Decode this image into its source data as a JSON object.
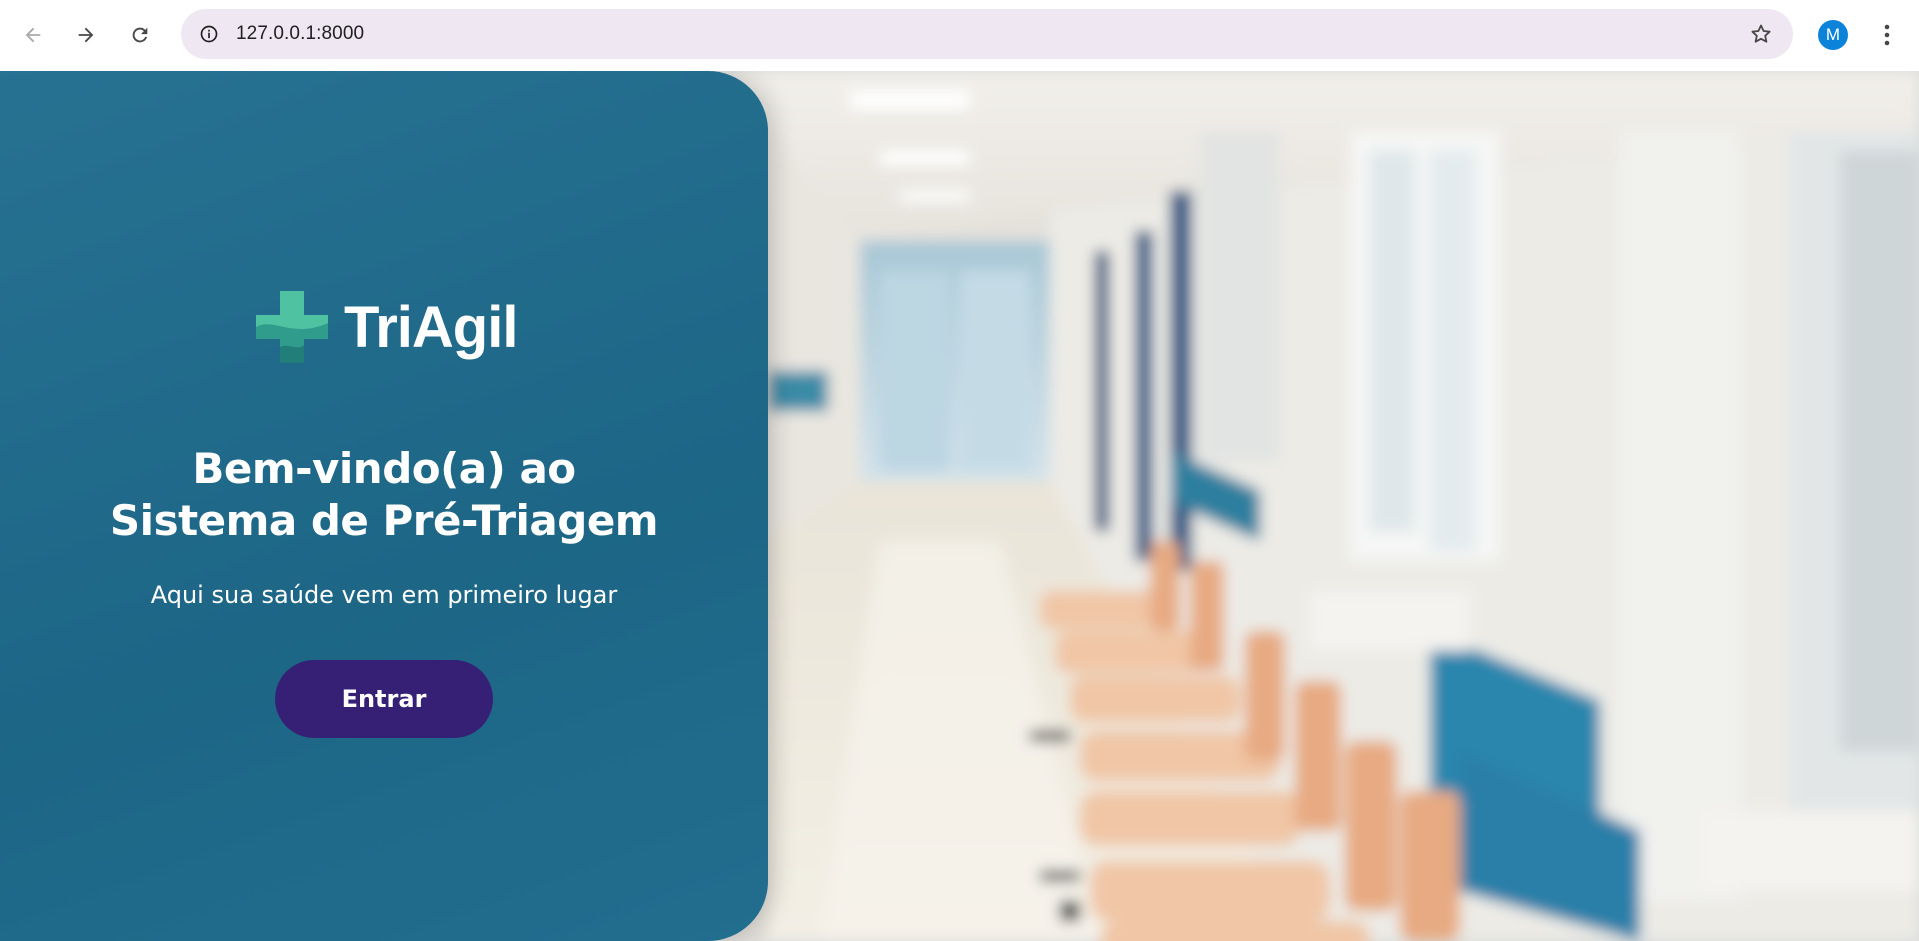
{
  "browser": {
    "url": "127.0.0.1:8000",
    "profile_initial": "M",
    "icons": {
      "back": "arrow-left-icon",
      "forward": "arrow-right-icon",
      "reload": "reload-icon",
      "site_info": "info-icon",
      "bookmark": "star-icon",
      "menu": "kebab-menu-icon"
    }
  },
  "page": {
    "logo": {
      "text": "TriAgil",
      "mark": "medical-cross-icon"
    },
    "heading": {
      "line1": "Bem-vindo(a) ao",
      "line2": "Sistema de Pré-Triagem"
    },
    "tagline": "Aqui sua saúde vem em primeiro lugar",
    "enter_button": "Entrar",
    "background_image": "hospital-hallway-photo"
  },
  "colors": {
    "panel": "#1e6b8d",
    "button": "#352076",
    "logo_teal": "#4fc3a1",
    "avatar": "#0b83d9"
  }
}
